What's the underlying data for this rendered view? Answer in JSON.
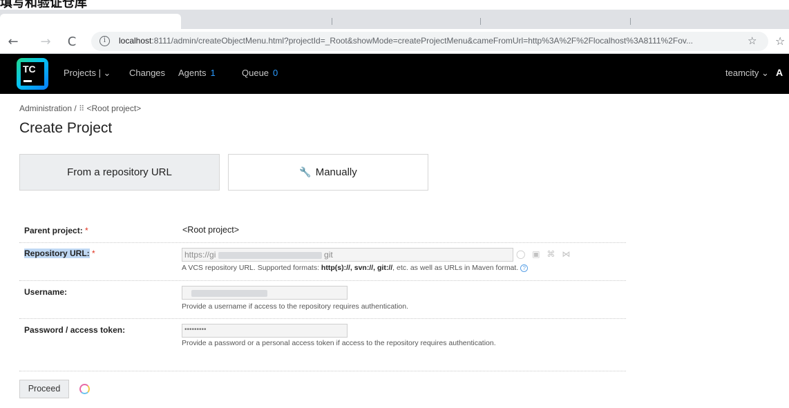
{
  "caption": "填写和验证仓库",
  "browser": {
    "back": "←",
    "forward": "→",
    "reload": "C",
    "url_host": "localhost",
    "url_rest": ":8111/admin/createObjectMenu.html?projectId=_Root&showMode=createProjectMenu&cameFromUrl=http%3A%2F%2Flocalhost%3A8111%2Fov...",
    "star": "☆",
    "ext": "☆"
  },
  "header": {
    "logo_text": "TC",
    "nav": {
      "projects": "Projects | ⌄",
      "changes": "Changes",
      "agents": "Agents",
      "agents_count": "1",
      "queue": "Queue",
      "queue_count": "0"
    },
    "user": "teamcity ⌄",
    "user_extra": "A"
  },
  "breadcrumb": {
    "admin": "Administration",
    "sep": "/",
    "grid_icon": "⠿",
    "root": "<Root project>"
  },
  "page_title": "Create Project",
  "modes": {
    "repo_url": "From a repository URL",
    "manual": "Manually",
    "wrench": "🔧"
  },
  "form": {
    "parent_label": "Parent project:",
    "parent_value": "<Root project>",
    "repo_label": "Repository URL:",
    "repo_value_start": "https://gi",
    "repo_value_end": "git",
    "repo_note_pre": "A VCS repository URL. Supported formats: ",
    "repo_note_formats": "http(s)://, svn://, git://",
    "repo_note_post": ", etc. as well as URLs in Maven format.",
    "help": "?",
    "vcs_icons": "◯ ▣ ⌘ ⋈",
    "username_label": "Username:",
    "username_note": "Provide a username if access to the repository requires authentication.",
    "password_label": "Password / access token:",
    "password_value": "•••••••••",
    "password_note": "Provide a password or a personal access token if access to the repository requires authentication.",
    "required_mark": "*"
  },
  "proceed": "Proceed"
}
